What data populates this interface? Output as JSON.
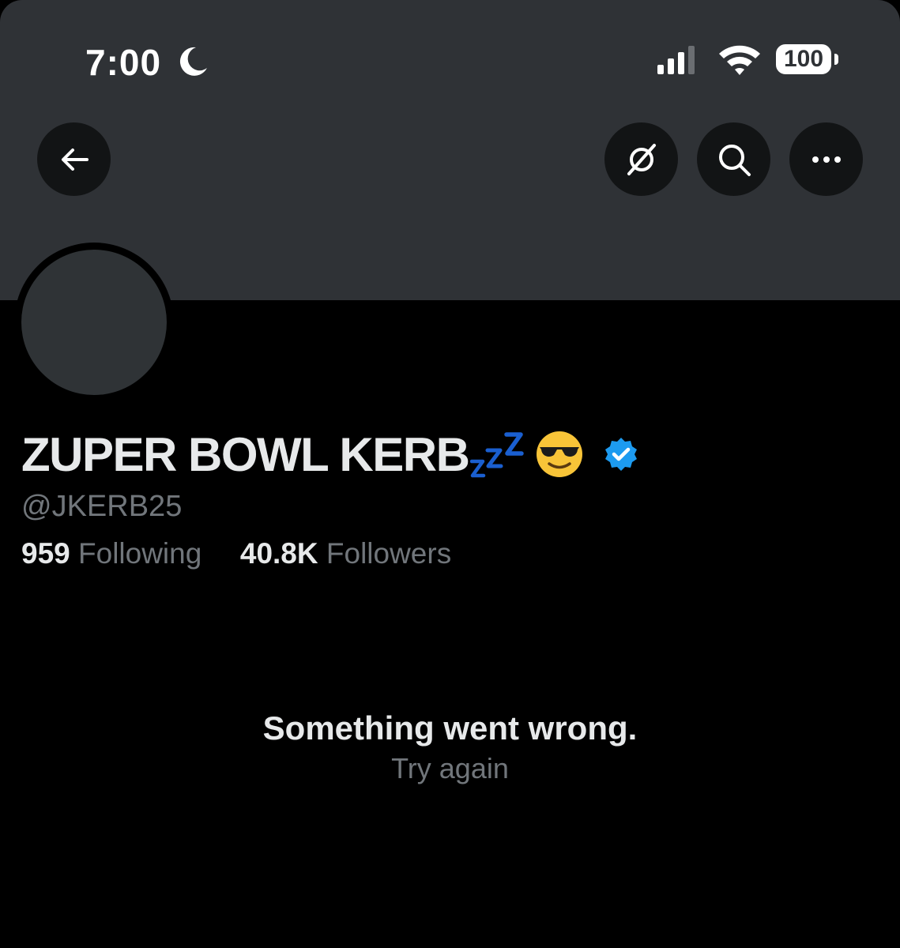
{
  "status_bar": {
    "time": "7:00",
    "battery": "100",
    "icons": [
      "moon-icon",
      "cellular-signal-icon",
      "wifi-icon",
      "battery-icon"
    ]
  },
  "toolbar": {
    "icons": [
      "back-arrow-icon",
      "grok-icon",
      "search-icon",
      "more-icon"
    ]
  },
  "profile": {
    "display_name": "ZUPER BOWL KERB",
    "name_emojis": [
      "zzz-emoji",
      "sunglasses-face-emoji"
    ],
    "handle": "@JKERB25",
    "verified_icon": "verified-badge-icon",
    "following_count": "959",
    "following_label": "Following",
    "followers_count": "40.8K",
    "followers_label": "Followers"
  },
  "error": {
    "message": "Something went wrong.",
    "retry_label": "Try again"
  },
  "colors": {
    "banner": "#2f3236",
    "background": "#000000",
    "primary_text": "#e7e9ea",
    "secondary_text": "#71767b",
    "verified_blue": "#1d9bf0",
    "zzz_blue": "#1a5fd0"
  }
}
